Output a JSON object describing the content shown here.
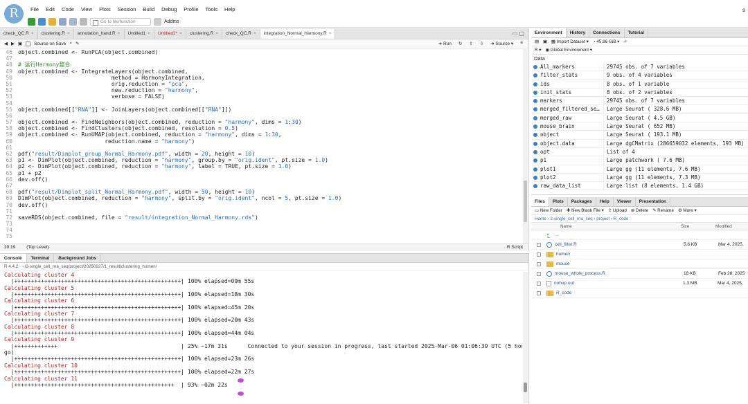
{
  "app": {
    "logo_letter": "R",
    "user_initial": "s"
  },
  "menu": [
    "File",
    "Edit",
    "Code",
    "View",
    "Plots",
    "Session",
    "Build",
    "Debug",
    "Profile",
    "Tools",
    "Help"
  ],
  "toolbar": {
    "goto_placeholder": "Go to file/function",
    "addins_label": "Addins"
  },
  "editor": {
    "tabs": [
      {
        "label": "check_QC.R"
      },
      {
        "label": "clustering.R"
      },
      {
        "label": "annotation_hand.R"
      },
      {
        "label": "Untitled1"
      },
      {
        "label": "Untitled2*"
      },
      {
        "label": "clustering.R"
      },
      {
        "label": "check_QC.R"
      },
      {
        "label": "integration_Normal_Harmony.R"
      }
    ],
    "source_on_save": "Source on Save",
    "run_label": "Run",
    "source_label": "Source",
    "lines": [
      {
        "n": "46",
        "t": "object.combined <- RunPCA(object.combined)"
      },
      {
        "n": "47",
        "t": ""
      },
      {
        "n": "48",
        "t": "# 运行Harmony整合"
      },
      {
        "n": "49",
        "t": "object.combined <- IntegrateLayers(object.combined,"
      },
      {
        "n": "50",
        "t": "                            method = HarmonyIntegration,"
      },
      {
        "n": "51",
        "t": "                            orig.reduction = \"pca\","
      },
      {
        "n": "52",
        "t": "                            new.reduction = \"harmony\","
      },
      {
        "n": "53",
        "t": "                            verbose = FALSE)"
      },
      {
        "n": "54",
        "t": ""
      },
      {
        "n": "55",
        "t": "object.combined[[\"RNA\"]] <- JoinLayers(object.combined[[\"RNA\"]])"
      },
      {
        "n": "56",
        "t": ""
      },
      {
        "n": "57",
        "t": "object.combined <- FindNeighbors(object.combined, reduction = \"harmony\", dims = 1:30)"
      },
      {
        "n": "58",
        "t": "object.combined <- FindClusters(object.combined, resolution = 0.5)"
      },
      {
        "n": "59",
        "t": "object.combined <- RunUMAP(object.combined, reduction = \"harmony\", dims = 1:30,"
      },
      {
        "n": "60",
        "t": "                          reduction.name = \"harmony\")"
      },
      {
        "n": "61",
        "t": ""
      },
      {
        "n": "62",
        "t": "pdf(\"result/Dimplot_group_Normal_Harmony.pdf\", width = 20, height = 10)"
      },
      {
        "n": "63",
        "t": "p1 <- DimPlot(object.combined, reduction = \"harmony\", group.by = \"orig.ident\", pt.size = 1.0)"
      },
      {
        "n": "64",
        "t": "p2 <- DimPlot(object.combined, reduction = \"harmony\", label = TRUE, pt.size = 1.0)"
      },
      {
        "n": "65",
        "t": "p1 + p2"
      },
      {
        "n": "66",
        "t": "dev.off()"
      },
      {
        "n": "67",
        "t": ""
      },
      {
        "n": "68",
        "t": "pdf(\"result/Dimplot_split_Normal_Harmony.pdf\", width = 50, height = 10)"
      },
      {
        "n": "69",
        "t": "DimPlot(object.combined, reduction = \"harmony\", split.by = \"orig.ident\", ncol = 5, pt.size = 1.0)"
      },
      {
        "n": "70",
        "t": "dev.off()"
      },
      {
        "n": "71",
        "t": ""
      },
      {
        "n": "72",
        "t": "saveRDS(object.combined, file = \"result/integration_Normal_Harmony.rds\")"
      },
      {
        "n": "73",
        "t": ""
      },
      {
        "n": "74",
        "t": ""
      },
      {
        "n": "75",
        "t": ""
      }
    ],
    "status": {
      "position": "20:19",
      "scope": "(Top Level)",
      "filetype": "R Script"
    }
  },
  "console": {
    "tabs": [
      "Console",
      "Terminal",
      "Background Jobs"
    ],
    "path": "R 4.4.2 · ~/2-single_cell_rna_seq/project/20250227/1_result/clustering_humen/",
    "lines": [
      {
        "t": "Calculating cluster 4",
        "red": true
      },
      {
        "t": "  |++++++++++++++++++++++++++++++++++++++++++++++++++| 100% elapsed=09m 55s",
        "red": false
      },
      {
        "t": "Calculating cluster 5",
        "red": true
      },
      {
        "t": "  |++++++++++++++++++++++++++++++++++++++++++++++++++| 100% elapsed=18m 30s",
        "red": false
      },
      {
        "t": "Calculating cluster 6",
        "red": true
      },
      {
        "t": "  |++++++++++++++++++++++++++++++++++++++++++++++++++| 100% elapsed=45m 20s",
        "red": false
      },
      {
        "t": "Calculating cluster 7",
        "red": true
      },
      {
        "t": "  |++++++++++++++++++++++++++++++++++++++++++++++++++| 100% elapsed=20m 43s",
        "red": false
      },
      {
        "t": "Calculating cluster 8",
        "red": true
      },
      {
        "t": "  |++++++++++++++++++++++++++++++++++++++++++++++++++| 100% elapsed=44m 04s",
        "red": false
      },
      {
        "t": "Calculating cluster 9",
        "red": true
      },
      {
        "t": "  |+++++++++++++                                     | 25% ~17m 31s      Connected to your session in progress, last started 2025-Mar-06 01:06:39 UTC (5 hours a",
        "red": false
      },
      {
        "t": "go)",
        "red": false
      },
      {
        "t": "  |++++++++++++++++++++++++++++++++++++++++++++++++++| 100% elapsed=23m 26s",
        "red": false
      },
      {
        "t": "Calculating cluster 10",
        "red": true
      },
      {
        "t": "  |++++++++++++++++++++++++++++++++++++++++++++++++++| 100% elapsed=22m 27s",
        "red": false
      },
      {
        "t": "Calculating cluster 11",
        "red": true
      },
      {
        "t": "  |++++++++++++++++++++++++++++++++++++++++++++++++  | 93% ~02m 22s",
        "red": false
      },
      {
        "t": "",
        "red": false
      }
    ]
  },
  "environment": {
    "tabs": [
      "Environment",
      "History",
      "Connections",
      "Tutorial"
    ],
    "import_label": "Import Dataset",
    "memory": "45.86 GiB",
    "lang": "R",
    "scope": "Global Environment",
    "section": "Data",
    "rows": [
      {
        "name": "All_markers",
        "value": "29745 obs. of 7 variables"
      },
      {
        "name": "filter_stats",
        "value": "9 obs. of 4 variables"
      },
      {
        "name": "ids",
        "value": "8 obs. of 1 variable"
      },
      {
        "name": "init_stats",
        "value": "8 obs. of 2 variables"
      },
      {
        "name": "markers",
        "value": "29745 obs. of 7 variables"
      },
      {
        "name": "merged_filtered_se…",
        "value": "Large Seurat ( 328.6 MB)"
      },
      {
        "name": "merged_raw",
        "value": "Large Seurat ( 4.5 GB)"
      },
      {
        "name": "mouse_brain",
        "value": "Large Seurat ( 652 MB)"
      },
      {
        "name": "object",
        "value": "Large Seurat ( 193.1 MB)"
      },
      {
        "name": "object.data",
        "value": "Large dgCMatrix (286659032 elements,  193 MB)"
      },
      {
        "name": "opt",
        "value": "List of  4"
      },
      {
        "name": "p1",
        "value": "Large patchwork ( 7.6 MB)"
      },
      {
        "name": "plot1",
        "value": "Large gg (11 elements,  7.6 MB)"
      },
      {
        "name": "plot2",
        "value": "Large gg (11 elements,  7.3 MB)"
      },
      {
        "name": "raw_data_list",
        "value": "Large list (8 elements,  1.4 GB)"
      }
    ]
  },
  "files": {
    "tabs": [
      "Files",
      "Plots",
      "Packages",
      "Help",
      "Viewer",
      "Presentation"
    ],
    "actions": [
      "New Folder",
      "New Blank File",
      "Upload",
      "Delete",
      "Rename",
      "More"
    ],
    "breadcrumb": "Home  ›  2-single_cell_rna_seq  ›  project  ›  R_code",
    "col_name": "Name",
    "col_size": "Size",
    "col_modified": "Modified",
    "rows": [
      {
        "icon": "up",
        "name": "..",
        "size": "",
        "date": ""
      },
      {
        "icon": "rfile",
        "name": "cell_filter.R",
        "size": "5.6 KB",
        "date": "Mar 4, 2025,"
      },
      {
        "icon": "folder",
        "name": "humen",
        "size": "",
        "date": ""
      },
      {
        "icon": "folder",
        "name": "mouse",
        "size": "",
        "date": ""
      },
      {
        "icon": "rfile",
        "name": "mouse_whole_process.R",
        "size": "18 KB",
        "date": "Feb 28, 2025"
      },
      {
        "icon": "doc",
        "name": "nohup.out",
        "size": "1.3 MB",
        "date": "Mar 4, 2025,"
      },
      {
        "icon": "folder",
        "name": "R_code",
        "size": "",
        "date": ""
      }
    ]
  },
  "colors": {
    "accent": "#75aadb",
    "error_red": "#b22222",
    "string_blue": "#2a6fbb"
  }
}
